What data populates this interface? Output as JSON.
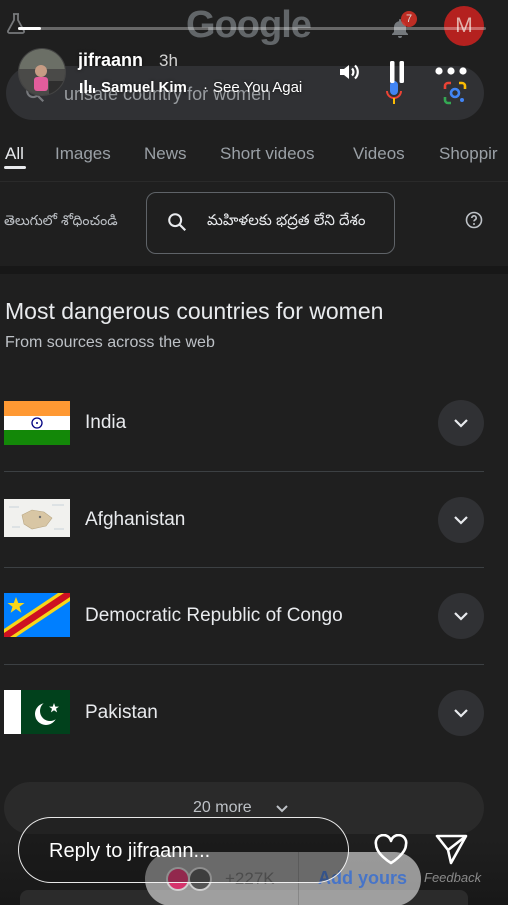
{
  "google": {
    "logo_text": "Google",
    "notification_count": "7",
    "account_initial": "M",
    "search_query": "unsafe country for women"
  },
  "tabs": [
    {
      "label": "All",
      "active": true
    },
    {
      "label": "Images"
    },
    {
      "label": "News"
    },
    {
      "label": "Short videos"
    },
    {
      "label": "Videos"
    },
    {
      "label": "Shoppir"
    }
  ],
  "translate": {
    "language_label": "తెలుగులో శోధించండి",
    "translated_query": "మహిళలకు భద్రత లేని దేశం"
  },
  "answer": {
    "title": "Most dangerous countries for women",
    "subtitle": "From sources across the web",
    "countries": [
      {
        "name": "India",
        "flag": "india-flag"
      },
      {
        "name": "Afghanistan",
        "flag": "afghanistan-map"
      },
      {
        "name": "Democratic Republic of Congo",
        "flag": "drc-flag"
      },
      {
        "name": "Pakistan",
        "flag": "pakistan-flag"
      }
    ],
    "more_label": "20 more"
  },
  "story": {
    "username": "jifraann",
    "time_ago": "3h",
    "progress": 0.05,
    "music_artist": "Samuel Kim",
    "music_separator": "·",
    "music_song": "See You Agai",
    "reply_placeholder": "Reply to jifraann...",
    "add_yours_count": "+227K",
    "add_yours_label": "Add yours",
    "feedback_label": "Feedback"
  },
  "colors": {
    "background": "#1f1f1f",
    "search_box": "#303134",
    "accent_blue": "#3a6fd1",
    "avatar_red": "#c5221f"
  }
}
